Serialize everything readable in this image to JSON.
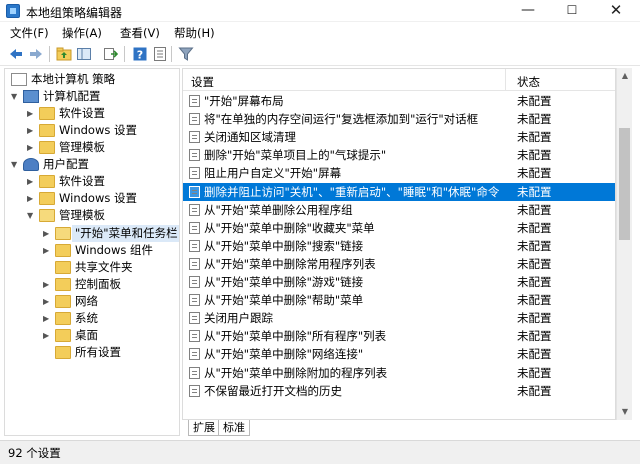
{
  "window": {
    "title": "本地组策略编辑器",
    "controls": {
      "minimize": "—",
      "maximize": "☐",
      "close": "✕"
    }
  },
  "menu": [
    "文件(F)",
    "操作(A)",
    "查看(V)",
    "帮助(H)"
  ],
  "toolbar": {
    "icons": [
      "back-arrow-icon",
      "forward-arrow-icon",
      "up-folder-icon",
      "show-hide-tree-icon",
      "export-list-icon",
      "help-icon",
      "properties-icon",
      "filter-icon"
    ]
  },
  "tree": {
    "root": "本地计算机 策略",
    "computer": "计算机配置",
    "computer_children": [
      "软件设置",
      "Windows 设置",
      "管理模板"
    ],
    "user": "用户配置",
    "user_children": [
      "软件设置",
      "Windows 设置",
      "管理模板"
    ],
    "admin_templates": [
      "\"开始\"菜单和任务栏",
      "Windows 组件",
      "共享文件夹",
      "控制面板",
      "网络",
      "系统",
      "桌面",
      "所有设置"
    ]
  },
  "list": {
    "col_setting": "设置",
    "col_state": "状态",
    "rows": [
      {
        "name": "\"开始\"屏幕布局",
        "state": "未配置"
      },
      {
        "name": "将\"在单独的内存空间运行\"复选框添加到\"运行\"对话框",
        "state": "未配置"
      },
      {
        "name": "关闭通知区域清理",
        "state": "未配置"
      },
      {
        "name": "删除\"开始\"菜单项目上的\"气球提示\"",
        "state": "未配置"
      },
      {
        "name": "阻止用户自定义\"开始\"屏幕",
        "state": "未配置"
      },
      {
        "name": "删除并阻止访问\"关机\"、\"重新启动\"、\"睡眠\"和\"休眠\"命令",
        "state": "未配置"
      },
      {
        "name": "从\"开始\"菜单删除公用程序组",
        "state": "未配置"
      },
      {
        "name": "从\"开始\"菜单中删除\"收藏夹\"菜单",
        "state": "未配置"
      },
      {
        "name": "从\"开始\"菜单中删除\"搜索\"链接",
        "state": "未配置"
      },
      {
        "name": "从\"开始\"菜单中删除常用程序列表",
        "state": "未配置"
      },
      {
        "name": "从\"开始\"菜单中删除\"游戏\"链接",
        "state": "未配置"
      },
      {
        "name": "从\"开始\"菜单中删除\"帮助\"菜单",
        "state": "未配置"
      },
      {
        "name": "关闭用户跟踪",
        "state": "未配置"
      },
      {
        "name": "从\"开始\"菜单中删除\"所有程序\"列表",
        "state": "未配置"
      },
      {
        "name": "从\"开始\"菜单中删除\"网络连接\"",
        "state": "未配置"
      },
      {
        "name": "从\"开始\"菜单中删除附加的程序列表",
        "state": "未配置"
      },
      {
        "name": "不保留最近打开文档的历史",
        "state": "未配置"
      }
    ]
  },
  "tabs": [
    "扩展",
    "标准"
  ],
  "status": "92 个设置",
  "colors": {
    "selection": "#0078d7",
    "folder": "#f3cd5a"
  }
}
